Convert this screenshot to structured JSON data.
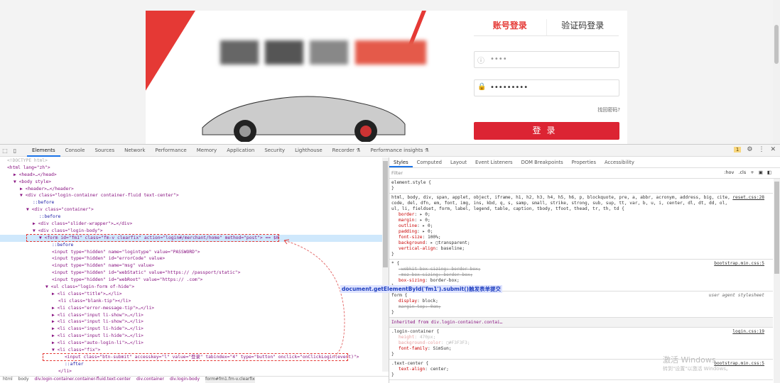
{
  "page": {
    "login_tabs": [
      "账号登录",
      "验证码登录"
    ],
    "username_value": "••••",
    "password_value": "•••••••••",
    "forgot_link": "找回密码?",
    "login_button": "登录"
  },
  "devtools": {
    "tabs": [
      "Elements",
      "Console",
      "Sources",
      "Network",
      "Performance",
      "Memory",
      "Application",
      "Security",
      "Lighthouse",
      "Recorder ⚗",
      "Performance insights ⚗"
    ],
    "issues_badge": "1",
    "elements_lines": [
      {
        "t": "<!DOCTYPE html>",
        "i": 0,
        "c": "muted"
      },
      {
        "t": "<html lang=\"zh\">",
        "i": 0
      },
      {
        "t": "▶ <head>…</head>",
        "i": 1
      },
      {
        "t": "▼ <body style>",
        "i": 1
      },
      {
        "t": "▶ <header>…</header>",
        "i": 2
      },
      {
        "t": "▼ <div class=\"login-container container-fluid text-center\">",
        "i": 2
      },
      {
        "t": "::before",
        "i": 4,
        "c": "pseudo"
      },
      {
        "t": "▼ <div class=\"container\">",
        "i": 3
      },
      {
        "t": "::before",
        "i": 5,
        "c": "pseudo"
      },
      {
        "t": "▶ <div class=\"slider-wrapper\">…</div>",
        "i": 4
      },
      {
        "t": "▼ <div class=\"login-body\">",
        "i": 4
      },
      {
        "t": "▼ <form id=\"fm1\" class=\"fm-v clearfix\" action=\"login#/merchant/home\" method=\"post\"> == $0",
        "i": 5,
        "c": "sel"
      },
      {
        "t": "::before",
        "i": 7,
        "c": "pseudo"
      },
      {
        "t": "<input type=\"hidden\" name=\"logintype\" value=\"PASSWORD\">",
        "i": 7
      },
      {
        "t": "<input type=\"hidden\" id=\"errorCode\" value>",
        "i": 7
      },
      {
        "t": "<input type=\"hidden\" name=\"msg\" value>",
        "i": 7
      },
      {
        "t": "<input type=\"hidden\" id=\"webStatic\" value=\"https://                          /passport/static\">",
        "i": 7
      },
      {
        "t": "<input type=\"hidden\" id=\"webRoot\" value=\"https://                   .com\">",
        "i": 7
      },
      {
        "t": "▼ <ul class=\"login-form of-hide\">",
        "i": 6
      },
      {
        "t": "▶ <li class=\"title\">…</li>",
        "i": 7
      },
      {
        "t": "<li class=\"blank-tip\"></li>",
        "i": 8
      },
      {
        "t": "▶ <li class=\"error-message-tip\">…</li>",
        "i": 7
      },
      {
        "t": "▶ <li class=\"input li-show\">…</li>",
        "i": 7
      },
      {
        "t": "▶ <li class=\"input li-show\">…</li>",
        "i": 7
      },
      {
        "t": "▶ <li class=\"input li-hide\">…</li>",
        "i": 7
      },
      {
        "t": "▶ <li class=\"input li-hide\">…</li>",
        "i": 7
      },
      {
        "t": "▶ <li class=\"auto-login-li\">…</li>",
        "i": 7
      },
      {
        "t": "▼ <li class=\"fix\">",
        "i": 7
      },
      {
        "t": "<input class=\"btn-submit\" accesskey=\"l\" value=\"登录\" tabindex=\"4\" type=\"button\" onclick=\"onClickLogin(event)\">",
        "i": 9
      },
      {
        "t": "::after",
        "i": 9,
        "c": "pseudo"
      },
      {
        "t": "</li>",
        "i": 8
      }
    ],
    "breadcrumbs": [
      "html",
      "body",
      "div.login-container.container-fluid.text-center",
      "div.container",
      "div.login-body",
      "form#fm1.fm-v.clearfix"
    ],
    "styles_tabs": [
      "Styles",
      "Computed",
      "Layout",
      "Event Listeners",
      "DOM Breakpoints",
      "Properties",
      "Accessibility"
    ],
    "filter_placeholder": "Filter",
    "filter_tools": [
      ":hov",
      ".cls",
      "+"
    ],
    "rules": [
      {
        "sel": "element.style {",
        "src": "",
        "props": []
      },
      {
        "sel": "html, body, div, span, applet, object, iframe, h1, h2, h3, h4, h5, h6, p, blockquote, pre, a, abbr, acronym, address, big, cite, code, del, dfn, em, font, img, ins, kbd, q, s, samp, small, strike, strong, sub, sup, tt, var, b, u, i, center, dl, dt, dd, ol, ul, li, fieldset, form, label, legend, table, caption, tbody, tfoot, thead, tr, th, td {",
        "src": "reset.css:28",
        "props": [
          {
            "n": "border",
            "v": "▸ 0;"
          },
          {
            "n": "margin",
            "v": "▸ 0;"
          },
          {
            "n": "outline",
            "v": "▸ 0;"
          },
          {
            "n": "padding",
            "v": "▸ 0;"
          },
          {
            "n": "font-size",
            "v": "100%;"
          },
          {
            "n": "background",
            "v": "▸ ▢transparent;"
          },
          {
            "n": "vertical-align",
            "v": "baseline;"
          }
        ]
      },
      {
        "sel": "* {",
        "src": "bootstrap.min.css:5",
        "props": [
          {
            "n": "-webkit-box-sizing",
            "v": "border-box;",
            "s": "struck"
          },
          {
            "n": "-moz-box-sizing",
            "v": "border-box;",
            "s": "struck"
          },
          {
            "n": "box-sizing",
            "v": "border-box;"
          }
        ]
      },
      {
        "sel": "form {",
        "src": "user agent stylesheet",
        "ua": true,
        "props": [
          {
            "n": "display",
            "v": "block;"
          },
          {
            "n": "margin-top",
            "v": "0em;",
            "s": "struck"
          }
        ]
      },
      {
        "inherited": "Inherited from",
        "inh_sel": "div.login-container.contai…"
      },
      {
        "sel": ".login-container {",
        "src": "login.css:19",
        "props": [
          {
            "n": "height",
            "v": "470px;",
            "s": "faded"
          },
          {
            "n": "background-color",
            "v": "▢#F3F3F3;",
            "s": "faded"
          },
          {
            "n": "font-family",
            "v": "SimSun;"
          }
        ]
      },
      {
        "sel": ".text-center {",
        "src": "bootstrap.min.css:5",
        "props": [
          {
            "n": "text-align",
            "v": "center;"
          }
        ]
      }
    ],
    "annotation": "document.getElementById('fm1').submit()触发表单提交",
    "watermark": [
      "激活 Windows",
      "转到\"设置\"以激活 Windows。"
    ]
  },
  "colors": {
    "accent": "#dc2433",
    "devtools_blue": "#1a73e8"
  }
}
